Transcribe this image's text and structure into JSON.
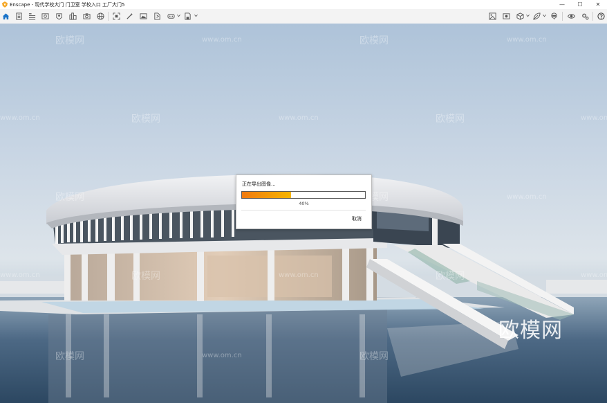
{
  "window": {
    "title": "Enscape - 现代学校大门 门卫室 学校入口 工厂大门5",
    "minimize_glyph": "—",
    "maximize_glyph": "☐",
    "close_glyph": "✕"
  },
  "toolbar": {
    "left_icons": [
      "home-icon",
      "document-icon",
      "list-icon",
      "video-icon",
      "eye-pin-icon",
      "building-icon",
      "camera-settings-icon",
      "globe-icon",
      "screenshot-icon",
      "magic-wand-icon",
      "image-icon",
      "export-file-icon",
      "vr-headset-icon",
      "save-icon"
    ],
    "right_icons": [
      "image-settings-icon",
      "photo-icon",
      "cube-icon",
      "leaf-icon",
      "vr-view-icon",
      "eye-icon",
      "gear-icon",
      "help-icon"
    ],
    "collapse_glyph": "⌃"
  },
  "viewport": {
    "watermarks": [
      "欧模网",
      "www.om.cn"
    ],
    "brand_watermark": "欧模网"
  },
  "export_dialog": {
    "title": "正在导出图像...",
    "progress": 0.4,
    "progress_text": "40%",
    "cancel_label": "取消"
  },
  "colors": {
    "accent": "#1a73c8",
    "progress_start": "#f07a10",
    "progress_end": "#f7b500"
  }
}
